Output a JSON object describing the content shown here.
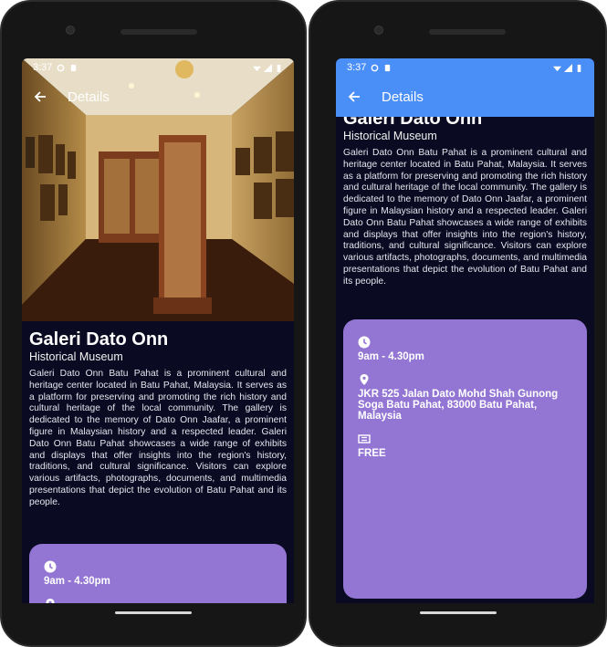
{
  "status": {
    "time": "3:37"
  },
  "app_bar": {
    "title": "Details"
  },
  "place": {
    "name": "Galeri Dato Onn",
    "category": "Historical Museum",
    "description": "Galeri Dato Onn Batu Pahat is a prominent cultural and heritage center located in Batu Pahat, Malaysia. It serves as a platform for preserving and promoting the rich history and cultural heritage of the local community. The gallery is dedicated to the memory of Dato Onn Jaafar, a prominent figure in Malaysian history and a respected leader. Galeri Dato Onn Batu Pahat showcases a wide range of exhibits and displays that offer insights into the region's history, traditions, and cultural significance. Visitors can explore various artifacts, photographs, documents, and multimedia presentations that depict the evolution of Batu Pahat and its people."
  },
  "info": {
    "hours": "9am  -  4.30pm",
    "address": "JKR 525 Jalan Dato Mohd Shah Gunong Soga Batu Pahat, 83000 Batu Pahat, Malaysia",
    "fee": "FREE"
  },
  "icons": {
    "back": "back-arrow-icon",
    "clock": "clock-icon",
    "location": "location-pin-icon",
    "ticket": "ticket-icon"
  },
  "colors": {
    "screen_bg": "#0a0a22",
    "app_bar": "#4a8ef7",
    "card": "#9376d4"
  }
}
